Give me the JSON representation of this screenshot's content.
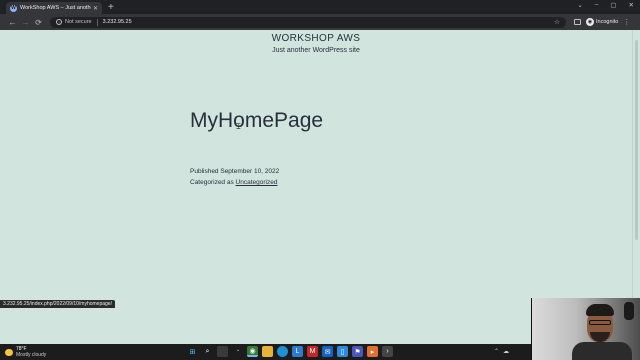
{
  "browser": {
    "tab": {
      "title": "WorkShop AWS – Just another W",
      "favicon": "wordpress-icon"
    },
    "new_tab": "+",
    "window_controls": {
      "tabsearch": "⌄",
      "minimize": "–",
      "maximize": "▢",
      "close": "✕"
    },
    "toolbar": {
      "back": "←",
      "forward": "→",
      "reload": "⟳",
      "security_label": "Not secure",
      "url": "3.232.95.25",
      "profile_label": "Incognito"
    },
    "status_url": "3.232.95.25/index.php/2022/09/10/myhomepage/"
  },
  "page": {
    "site_title": "WORKSHOP AWS",
    "site_description": "Just another WordPress site",
    "post_title": "MyHomePage",
    "published": "Published September 10, 2022",
    "categorized_prefix": "Categorized as",
    "category": "Uncategorized"
  },
  "taskbar": {
    "weather_temp": "78°F",
    "weather_condition": "Mostly cloudy",
    "apps": [
      "windows-start-icon",
      "search-icon",
      "task-view-icon",
      "chat-icon",
      "chrome-icon",
      "file-explorer-icon",
      "edge-icon",
      "store-icon",
      "mcafee-icon",
      "mail-icon",
      "phone-icon",
      "teams-icon",
      "vscode-icon",
      "terminal-icon"
    ]
  },
  "colors": {
    "page_background": "#d1e4dd",
    "text": "#28303d",
    "browser_dark": "#202124",
    "browser_toolbar": "#35363a"
  }
}
